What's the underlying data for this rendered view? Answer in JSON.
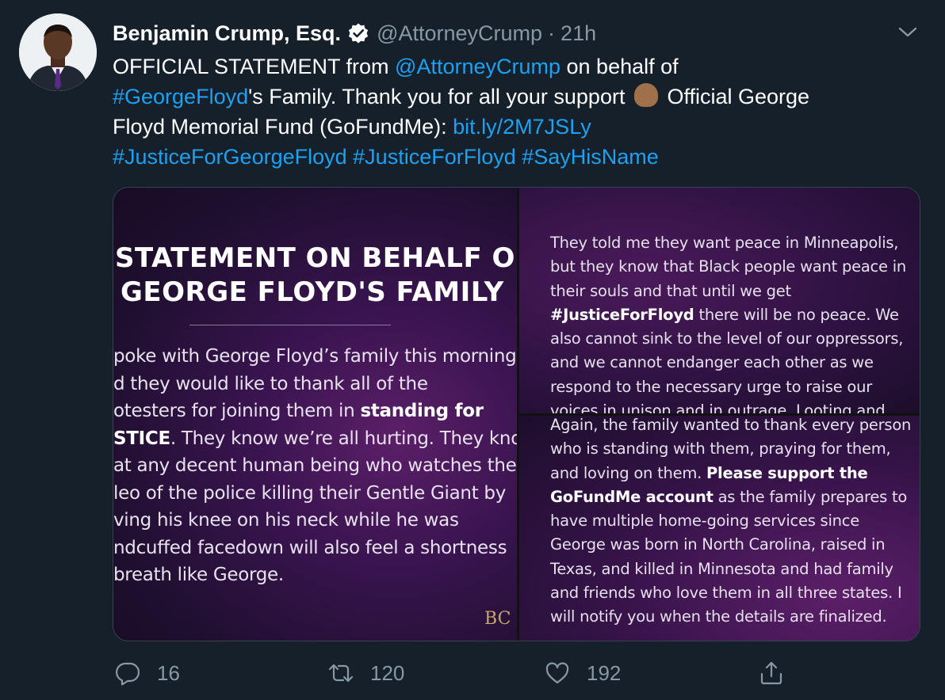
{
  "tweet": {
    "author_name": "Benjamin Crump, Esq.",
    "handle": "@AttorneyCrump",
    "separator": "·",
    "time": "21h",
    "text": {
      "l1_a": "OFFICIAL STATEMENT from ",
      "l1_mention": "@AttorneyCrump",
      "l1_b": " on behalf of",
      "l2_hashtag": "#GeorgeFloyd",
      "l2_b": "'s Family. Thank you for all your support ",
      "l2_c": " Official George",
      "l3_a": "Floyd Memorial Fund (GoFundMe): ",
      "l3_link": "bit.ly/2M7JSLy",
      "l4_h1": "#JusticeForGeorgeFloyd",
      "l4_h2": "#JusticeForFloyd",
      "l4_h3": "#SayHisName"
    }
  },
  "media": {
    "left": {
      "title_1": "STATEMENT ON BEHALF OF",
      "title_2": "GEORGE FLOYD'S FAMILY",
      "body": [
        "poke with George Floyd’s family this morning",
        "d they would like to thank all of the",
        "otesters for joining them in ",
        "STICE",
        ". They know we’re all hurting. They know",
        "at any decent human being who watches the",
        "leo of the police killing their Gentle Giant by",
        "ving his knee on his neck while he was",
        "ndcuffed facedown will also feel a shortness",
        " breath like George."
      ],
      "bold_phrase": "standing for",
      "monogram": "BC"
    },
    "top_right": {
      "lines": [
        "They told me they want peace in Minneapolis,",
        "but they know that Black people want peace in",
        "their souls and that until we get",
        "#JusticeForFloyd",
        " there will be no peace. We",
        "also cannot sink to the level of our oppressors,",
        "and we cannot endanger each other as we",
        "respond to the necessary urge to raise our",
        "voices in unison and in outrage. Looting and"
      ]
    },
    "bottom_right": {
      "lines": [
        "Again, the family wanted to thank every person",
        "who is standing with them, praying for them,",
        "and loving on them. ",
        "Please support the",
        "GoFundMe account",
        " as the family prepares to",
        "have multiple home-going services since",
        "George was born in North Carolina, raised in",
        "Texas, and killed in Minnesota and had family",
        "and friends who love them in all three states. I",
        "will notify you when the details are finalized."
      ]
    }
  },
  "actions": {
    "reply_count": "16",
    "retweet_count": "120",
    "like_count": "192"
  },
  "icons": {
    "verified": "verified-badge-icon",
    "caret": "chevron-down-icon",
    "reply": "reply-icon",
    "retweet": "retweet-icon",
    "like": "heart-icon",
    "share": "share-icon"
  },
  "colors": {
    "background": "#15202b",
    "link": "#1da1f2",
    "secondary_text": "#8899a6"
  }
}
